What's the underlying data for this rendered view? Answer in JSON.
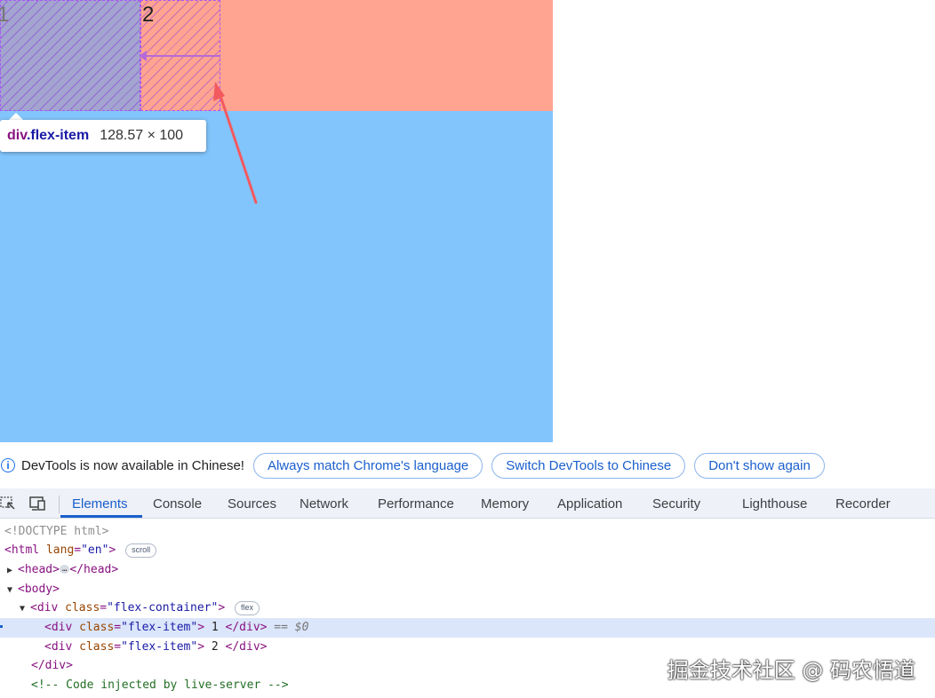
{
  "page": {
    "item1_text": "1",
    "item2_text": "2",
    "colors": {
      "container": "#ffa490",
      "body_bg": "#82c5fc",
      "item1": "#a3a4cf"
    }
  },
  "tooltip": {
    "tag": "div",
    "class": ".flex-item",
    "size": "128.57 × 100"
  },
  "infobar": {
    "message": "DevTools is now available in Chinese!",
    "buttons": [
      "Always match Chrome's language",
      "Switch DevTools to Chinese",
      "Don't show again"
    ]
  },
  "devtools": {
    "tabs": [
      "Elements",
      "Console",
      "Sources",
      "Network",
      "Performance",
      "Memory",
      "Application",
      "Security",
      "Lighthouse",
      "Recorder"
    ],
    "active_tab": "Elements"
  },
  "tree": {
    "doctype": "<!DOCTYPE html>",
    "html_open": "<html",
    "html_attr": "lang",
    "html_val": "\"en\"",
    "scroll_badge": "scroll",
    "head_open": "<head>",
    "head_ellipsis": "…",
    "head_close": "</head>",
    "body_open": "<body>",
    "div_open": "<div",
    "class_attr": "class",
    "container_val": "\"flex-container\"",
    "flex_badge": "flex",
    "item_val": "\"flex-item\"",
    "item1_text": " 1 ",
    "item2_text": " 2 ",
    "div_close": "</div>",
    "selected_ref": " == $0",
    "comment": "<!-- Code injected by live-server -->"
  },
  "watermark": "掘金技术社区 @ 码农悟道"
}
